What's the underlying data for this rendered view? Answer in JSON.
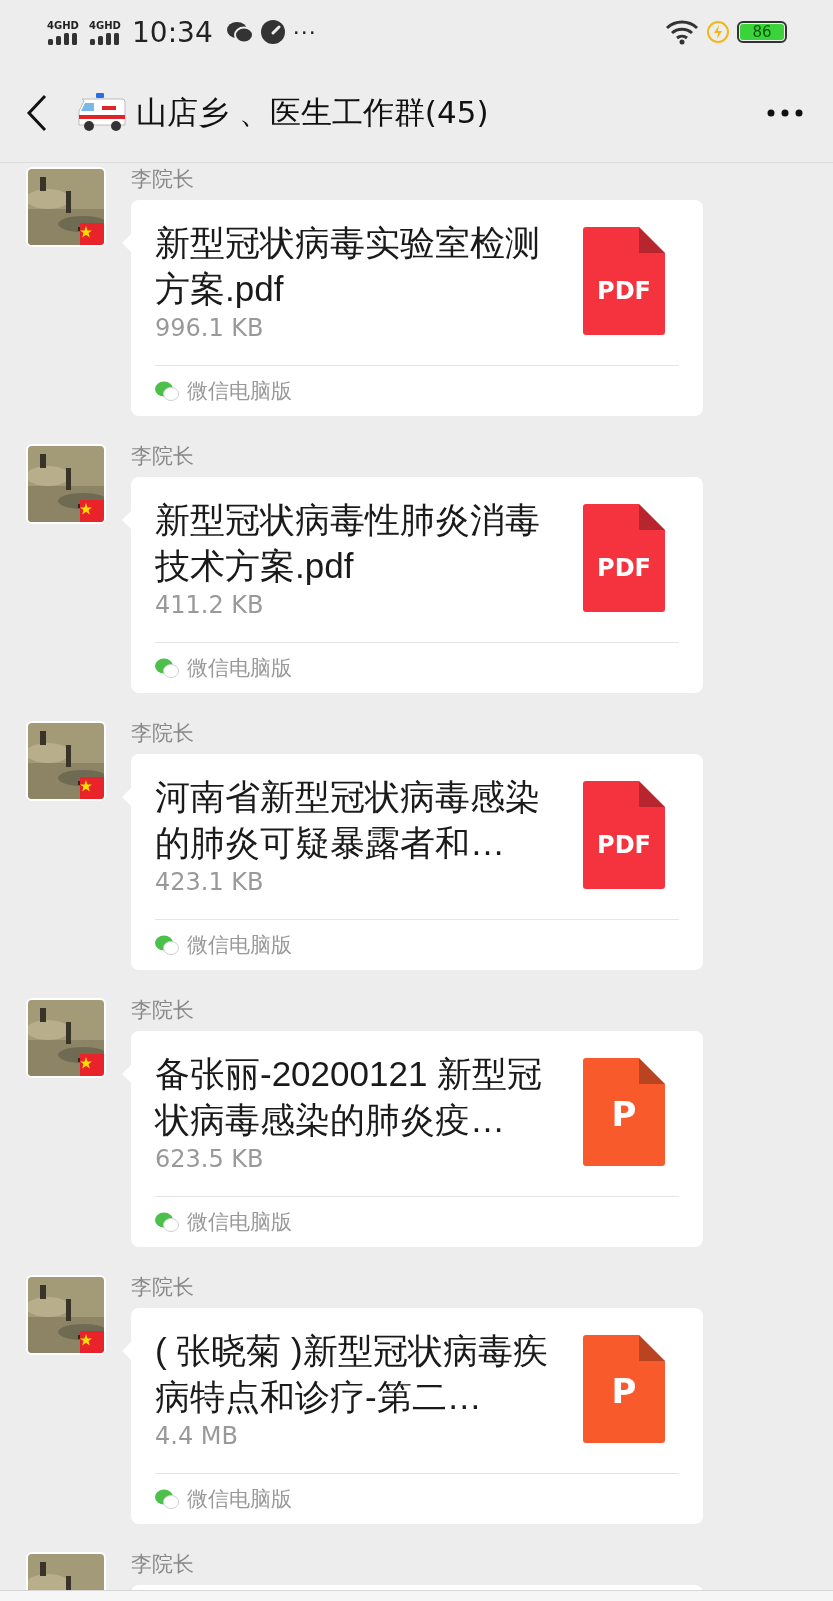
{
  "status_bar": {
    "networks": [
      "4GHD",
      "4GHD"
    ],
    "time": "10:34",
    "more": "···",
    "battery": "86"
  },
  "title_bar": {
    "title": "山店乡 、医生工作群(45)"
  },
  "messages": [
    {
      "sender": "李院长",
      "file": {
        "name": "新型冠状病毒实验室检测方案.pdf",
        "size": "996.1 KB",
        "kind": "pdf",
        "icon_label": "PDF"
      },
      "source": "微信电脑版"
    },
    {
      "sender": "李院长",
      "file": {
        "name": "新型冠状病毒性肺炎消毒技术方案.pdf",
        "size": "411.2 KB",
        "kind": "pdf",
        "icon_label": "PDF"
      },
      "source": "微信电脑版"
    },
    {
      "sender": "李院长",
      "file": {
        "name": "河南省新型冠状病毒感染的肺炎可疑暴露者和…",
        "size": "423.1 KB",
        "kind": "pdf",
        "icon_label": "PDF"
      },
      "source": "微信电脑版"
    },
    {
      "sender": "李院长",
      "file": {
        "name": "备张丽-20200121 新型冠状病毒感染的肺炎疫…",
        "size": "623.5 KB",
        "kind": "ppt",
        "icon_label": "P"
      },
      "source": "微信电脑版"
    },
    {
      "sender": "李院长",
      "file": {
        "name": "( 张晓菊 )新型冠状病毒疾病特点和诊疗-第二…",
        "size": "4.4 MB",
        "kind": "ppt",
        "icon_label": "P"
      },
      "source": "微信电脑版"
    },
    {
      "sender": "李院长"
    }
  ]
}
